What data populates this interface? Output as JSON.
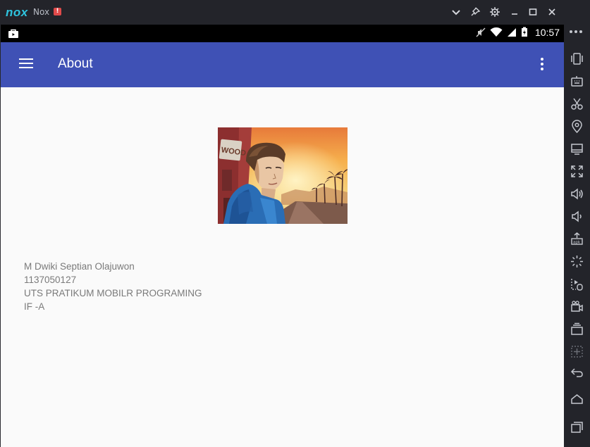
{
  "window": {
    "logo": "nox",
    "title": "Nox",
    "alert_badge": "!",
    "controls": [
      "chevron-down-icon",
      "pin-icon",
      "gear-icon",
      "minimize-icon",
      "maximize-icon",
      "close-icon"
    ]
  },
  "statusbar": {
    "time": "10:57",
    "icons": [
      "mute-icon",
      "wifi-icon",
      "signal-icon",
      "battery-icon"
    ]
  },
  "appbar": {
    "title": "About",
    "color": "#3f51b5"
  },
  "profile": {
    "name": "M Dwiki Septian Olajuwon",
    "student_id": "1137050127",
    "course": "UTS PRATIKUM MOBILR PROGRAMING",
    "class": "IF -A",
    "photo_sign_text": "WOOD"
  },
  "sidebar": {
    "tools": [
      "shake-icon",
      "keyboard-icon",
      "scissors-icon",
      "location-icon",
      "screen-icon",
      "fullscreen-icon",
      "volume-up-icon",
      "volume-down-icon",
      "apk-icon",
      "loading-icon",
      "macro-icon",
      "video-icon",
      "multi-instance-icon",
      "add-icon",
      "back-icon",
      "home-icon",
      "recents-icon"
    ]
  }
}
